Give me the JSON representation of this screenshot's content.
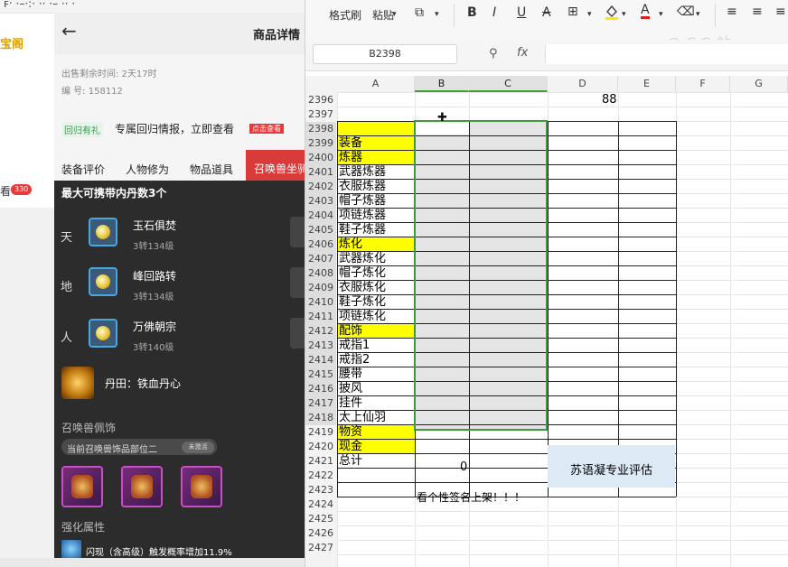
{
  "browser": {
    "top_strip_text": "ꜰ‧ ·–·:· ·· ·– ·· ·",
    "logo_text": "宝阁",
    "left_fragment": "看",
    "left_badge": "330"
  },
  "product": {
    "title": "商品详情",
    "sell_time": "出售剩余时间: 2天17时",
    "serial": "编 号: 158112",
    "return_tag": "回归有礼",
    "return_text": "专属回归情报，立即查看",
    "check_badge": "点击查看",
    "tabs": [
      "装备评价",
      "人物修为",
      "物品道具",
      "召唤兽坐骑"
    ]
  },
  "pet_panel": {
    "title": "最大可携带内丹数3个",
    "slots": [
      {
        "char": "天",
        "name": "玉石俱焚",
        "level": "3转134级"
      },
      {
        "char": "地",
        "name": "峰回路转",
        "level": "3转134级"
      },
      {
        "char": "人",
        "name": "万佛朝宗",
        "level": "3转140级"
      }
    ],
    "dantian": "丹田：铁血丹心",
    "ornament_title": "召唤兽佩饰",
    "ornament_pill": "当前召唤兽饰品部位二",
    "ornament_pill_btn": "未激活",
    "strengthen_title": "强化属性",
    "flash_text": "闪现（含高级）触发概率增加11.9%"
  },
  "ribbon": {
    "format_painter": "格式刷",
    "paste": "粘贴",
    "bold": "B",
    "italic": "I",
    "underline": "U",
    "strike": "A",
    "font_color": "A",
    "watermark": "@ C O 站"
  },
  "formula_bar": {
    "name_box": "B2398",
    "fx": "fx",
    "value": ""
  },
  "columns": [
    "A",
    "B",
    "C",
    "D",
    "E",
    "F",
    "G"
  ],
  "rows": [
    "2396",
    "2397",
    "2398",
    "2399",
    "2400",
    "2401",
    "2402",
    "2403",
    "2404",
    "2405",
    "2406",
    "2407",
    "2408",
    "2409",
    "2410",
    "2411",
    "2412",
    "2413",
    "2414",
    "2415",
    "2416",
    "2417",
    "2418",
    "2419",
    "2420",
    "2421",
    "2422",
    "2423",
    "2424",
    "2425",
    "2426",
    "2427"
  ],
  "cells": {
    "D2396": "88",
    "A": [
      "",
      "",
      "",
      "装备",
      "炼器",
      "武器炼器",
      "衣服炼器",
      "帽子炼器",
      "项链炼器",
      "鞋子炼器",
      "炼化",
      "武器炼化",
      "帽子炼化",
      "衣服炼化",
      "鞋子炼化",
      "项链炼化",
      "配饰",
      "戒指1",
      "戒指2",
      "腰带",
      "披风",
      "挂件",
      "太上仙羽",
      "物资",
      "现金",
      "总计",
      "",
      "",
      "",
      "",
      "",
      ""
    ],
    "B2421": "0",
    "eval": "苏语凝专业评估",
    "sign": "看个性签名上架！！！"
  },
  "colors": {
    "highlight": "#ffff00",
    "selection_border": "#3f9a3f",
    "eval_fill": "#dde9f5",
    "accent_red": "#d93a3a"
  }
}
